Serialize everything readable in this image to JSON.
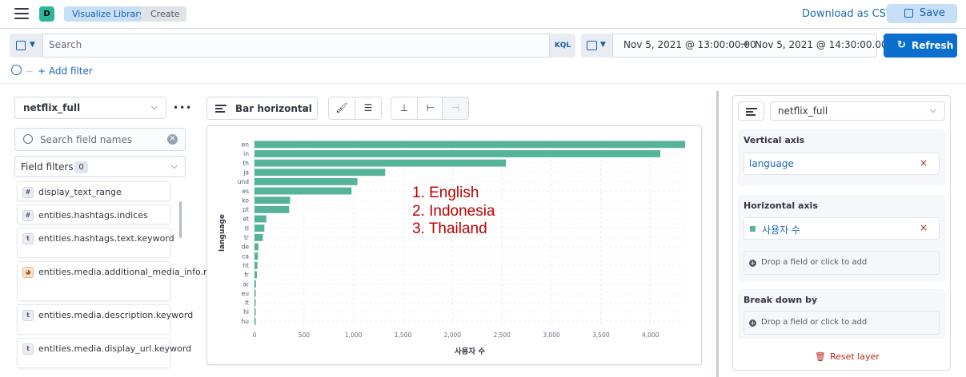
{
  "header": {
    "avatar_letter": "D",
    "breadcrumbs": [
      "Visualize Library",
      "Create"
    ],
    "download_label": "Download as CSV",
    "save_label": "Save"
  },
  "query": {
    "search_placeholder": "Search",
    "language_label": "KQL",
    "date_from": "Nov 5, 2021 @ 13:00:00.00",
    "date_arrow": "→",
    "date_to": "Nov 5, 2021 @ 14:30:00.00",
    "refresh_label": "Refresh",
    "add_filter_label": "+ Add filter"
  },
  "left_panel": {
    "data_view": "netflix_full",
    "search_placeholder": "Search field names",
    "field_filters_label": "Field filters",
    "field_filters_count": "0",
    "fields": [
      {
        "type": "#",
        "name": "display_text_range"
      },
      {
        "type": "#",
        "name": "entities.hashtags.indices"
      },
      {
        "type": "t",
        "name": "entities.hashtags.text.keyword"
      },
      {
        "type": "geo",
        "name": "entities.media.additional_media_info.monetizable"
      },
      {
        "type": "t",
        "name": "entities.media.description.keyword"
      },
      {
        "type": "t",
        "name": "entities.media.display_url.keyword"
      }
    ]
  },
  "workspace": {
    "chart_type_label": "Bar horizontal"
  },
  "chart_data": {
    "type": "bar",
    "orientation": "horizontal",
    "categories": [
      "en",
      "in",
      "th",
      "ja",
      "und",
      "es",
      "ko",
      "pt",
      "et",
      "tl",
      "tr",
      "de",
      "ca",
      "ht",
      "fr",
      "ar",
      "eu",
      "it",
      "hi",
      "hu"
    ],
    "values": [
      4350,
      4100,
      2540,
      1320,
      1040,
      980,
      360,
      350,
      120,
      100,
      85,
      40,
      35,
      30,
      25,
      15,
      12,
      10,
      8,
      6
    ],
    "xlabel": "사용자 수",
    "ylabel": "language",
    "xlim": [
      0,
      4350
    ],
    "x_ticks": [
      "0",
      "500",
      "1,000",
      "1,500",
      "2,000",
      "2,500",
      "3,000",
      "3,500",
      "4,000"
    ],
    "bar_color": "#54b399",
    "grid": true
  },
  "annotation": {
    "lines": [
      "1. English",
      "2. Indonesia",
      "3. Thailand"
    ]
  },
  "right_panel": {
    "data_view": "netflix_full",
    "vertical_axis_title": "Vertical axis",
    "vertical_axis_field": "language",
    "horizontal_axis_title": "Horizontal axis",
    "horizontal_axis_field": "사용자 수",
    "drop_label": "Drop a field or click to add",
    "breakdown_title": "Break down by",
    "reset_label": "Reset layer",
    "remove_symbol": "×"
  }
}
